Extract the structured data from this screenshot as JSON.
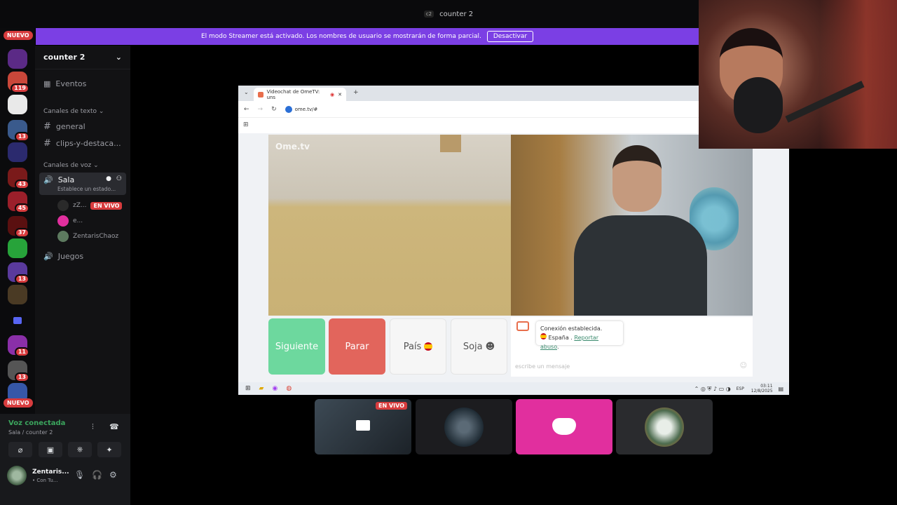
{
  "window": {
    "server_tag": "c2",
    "title": "counter 2"
  },
  "rail": {
    "nuevo_top": "NUEVO",
    "nuevo_bottom": "NUEVO",
    "servers": [
      {
        "badge": ""
      },
      {
        "badge": "119"
      },
      {
        "badge": ""
      },
      {
        "badge": "13"
      },
      {
        "badge": ""
      },
      {
        "badge": "43"
      },
      {
        "badge": "45"
      },
      {
        "badge": "37"
      },
      {
        "badge": ""
      },
      {
        "badge": "13"
      },
      {
        "badge": ""
      },
      {
        "badge": "11"
      },
      {
        "badge": "13"
      }
    ]
  },
  "banner": {
    "text": "El modo Streamer está activado. Los nombres de usuario se mostrarán de forma parcial.",
    "button": "Desactivar"
  },
  "sidebar": {
    "guild_name": "counter 2",
    "events_label": "Eventos",
    "text_category": "Canales de texto",
    "text_channels": [
      "general",
      "clips-y-destaca..."
    ],
    "voice_category": "Canales de voz",
    "active_voice": {
      "name": "Sala",
      "status": "Establece un estado..."
    },
    "voice_users": [
      {
        "name": "zZ...",
        "live": "EN VIVO"
      },
      {
        "name": "e..."
      },
      {
        "name": "ZentarisChaoz"
      }
    ],
    "other_voice": "Juegos"
  },
  "userpanel": {
    "voice_status": "Voz conectada",
    "voice_location": "Sala / counter 2",
    "user_name": "Zentaris...",
    "user_status": "• Con Tu..."
  },
  "browser": {
    "tab_title": "Videochat de OmeTV: uns",
    "url": "ome.tv/#",
    "logo": "Ome.tv",
    "buttons": {
      "next": "Siguiente",
      "stop": "Parar",
      "country": "País",
      "gender": "Soja"
    },
    "chat": {
      "message": "Conexión establecida.",
      "country": "España",
      "report": "Reportar abuso",
      "placeholder": "escribe un mensaje"
    },
    "taskbar": {
      "lang": "ESP",
      "time": "03:11",
      "date": "12/8/2025"
    }
  },
  "thumbnails": {
    "live": "EN VIVO"
  },
  "colors": {
    "accent": "#7b3fe4",
    "live": "#d83c3e",
    "voice": "#3ba55d",
    "next": "#6dd89e",
    "stop": "#e2655c"
  }
}
